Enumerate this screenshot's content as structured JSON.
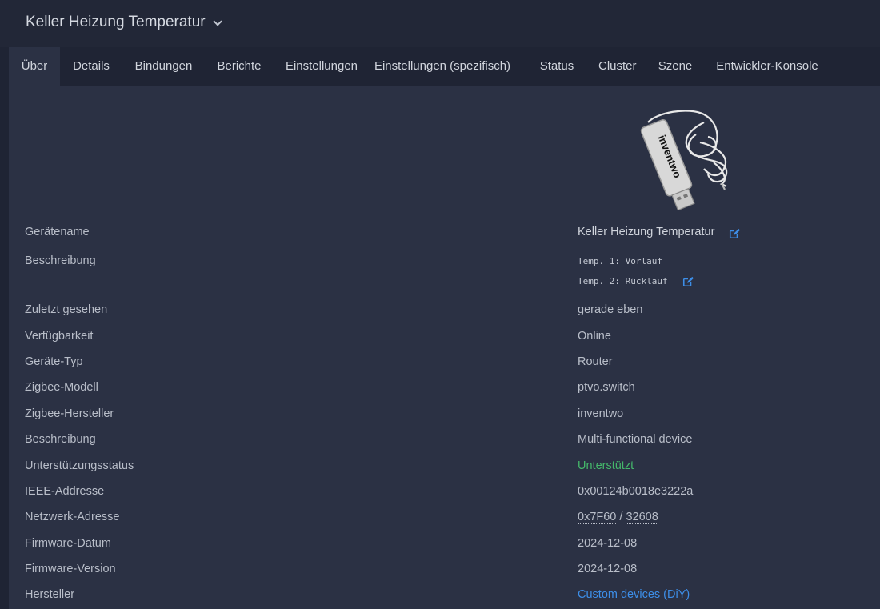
{
  "header": {
    "device_name": "Keller Heizung Temperatur"
  },
  "tabs": [
    {
      "label": "Über",
      "active": true
    },
    {
      "label": "Details"
    },
    {
      "label": "Bindungen"
    },
    {
      "label": "Berichte"
    },
    {
      "label": "Einstellungen"
    },
    {
      "label": "Einstellungen (spezifisch)"
    },
    {
      "label": "Status"
    },
    {
      "label": "Cluster"
    },
    {
      "label": "Szene"
    },
    {
      "label": "Entwickler-Konsole"
    }
  ],
  "device_image": {
    "brand_text": "inventwo"
  },
  "info": {
    "device_name": {
      "label": "Gerätename",
      "value": "Keller Heizung Temperatur"
    },
    "description_user": {
      "label": "Beschreibung",
      "line1": "Temp. 1: Vorlauf",
      "line2": "Temp. 2: Rücklauf"
    },
    "last_seen": {
      "label": "Zuletzt gesehen",
      "value": "gerade eben"
    },
    "availability": {
      "label": "Verfügbarkeit",
      "value": "Online"
    },
    "device_type": {
      "label": "Geräte-Typ",
      "value": "Router"
    },
    "zigbee_model": {
      "label": "Zigbee-Modell",
      "value": "ptvo.switch"
    },
    "zigbee_manufacturer": {
      "label": "Zigbee-Hersteller",
      "value": "inventwo"
    },
    "description": {
      "label": "Beschreibung",
      "value": "Multi-functional device"
    },
    "support_status": {
      "label": "Unterstützungsstatus",
      "value": "Unterstützt"
    },
    "ieee_address": {
      "label": "IEEE-Addresse",
      "value": "0x00124b0018e3222a"
    },
    "network_address": {
      "label": "Netzwerk-Adresse",
      "hex": "0x7F60",
      "separator": " / ",
      "dec": "32608"
    },
    "firmware_date": {
      "label": "Firmware-Datum",
      "value": "2024-12-08"
    },
    "firmware_version": {
      "label": "Firmware-Version",
      "value": "2024-12-08"
    },
    "manufacturer": {
      "label": "Hersteller",
      "value": "Custom devices (DiY)"
    }
  },
  "colors": {
    "supported": "#45b86b",
    "link": "#3d8ee8",
    "edit_icon": "#3d8ee8"
  },
  "icons": {
    "edit": "edit-icon",
    "caret": "chevron-down-icon"
  }
}
